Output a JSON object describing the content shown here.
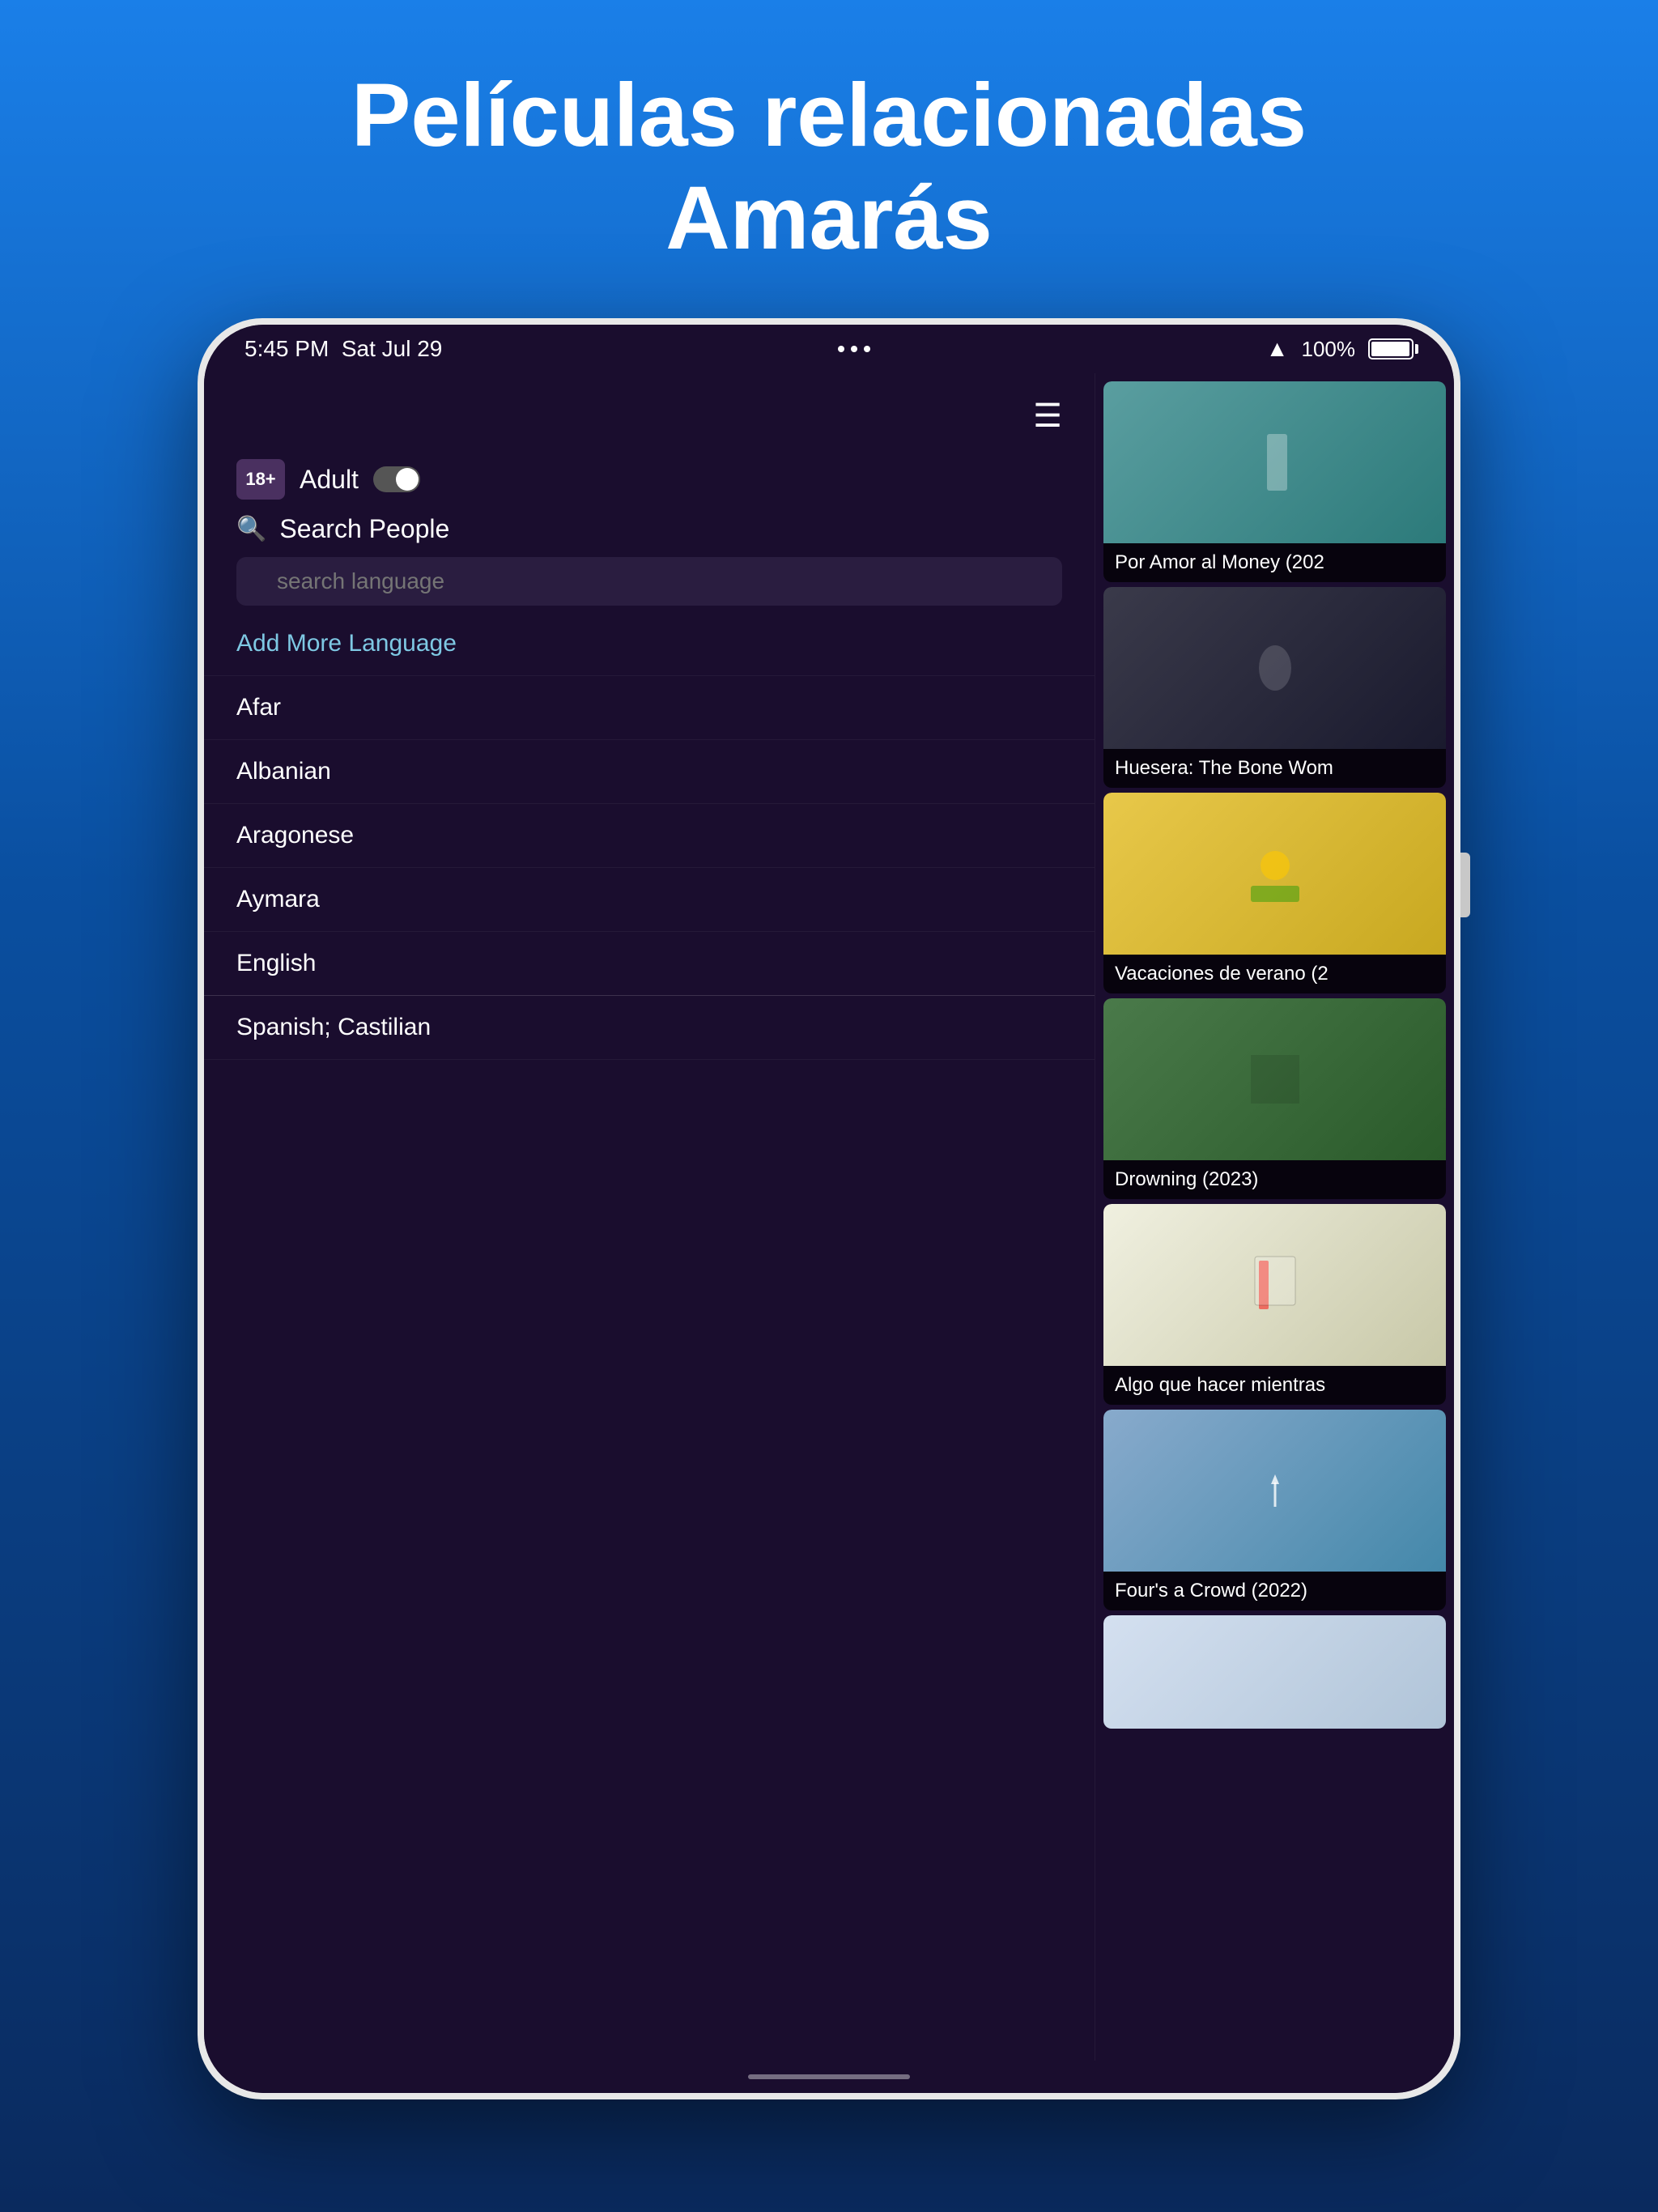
{
  "hero": {
    "title_line1": "Películas relacionadas",
    "title_line2": "Amarás"
  },
  "status_bar": {
    "time": "5:45 PM",
    "date": "Sat Jul 29",
    "wifi": "WiFi",
    "battery_percent": "100%"
  },
  "menu_icon": "☰",
  "adult_section": {
    "icon_label": "18+",
    "label": "Adult",
    "toggle_on": false
  },
  "search_people": {
    "label": "Search People"
  },
  "search_language": {
    "placeholder": "search language"
  },
  "language_list": [
    {
      "id": "add-more",
      "label": "Add More Language",
      "type": "add"
    },
    {
      "id": "afar",
      "label": "Afar",
      "type": "lang"
    },
    {
      "id": "albanian",
      "label": "Albanian",
      "type": "lang"
    },
    {
      "id": "aragonese",
      "label": "Aragonese",
      "type": "lang"
    },
    {
      "id": "aymara",
      "label": "Aymara",
      "type": "lang"
    },
    {
      "id": "english",
      "label": "English",
      "type": "lang"
    },
    {
      "id": "spanish",
      "label": "Spanish; Castilian",
      "type": "lang"
    }
  ],
  "movies": [
    {
      "id": "1",
      "title": "Por Amor al Money (202",
      "thumb_class": "thumb-1"
    },
    {
      "id": "2",
      "title": "Huesera: The Bone Wom",
      "thumb_class": "thumb-2"
    },
    {
      "id": "3",
      "title": "Vacaciones de verano (2",
      "thumb_class": "thumb-3"
    },
    {
      "id": "4",
      "title": "Drowning (2023)",
      "thumb_class": "thumb-4"
    },
    {
      "id": "5",
      "title": "Algo que hacer mientras",
      "thumb_class": "thumb-5"
    },
    {
      "id": "6",
      "title": "Four's a Crowd (2022)",
      "thumb_class": "thumb-6"
    },
    {
      "id": "7",
      "title": "",
      "thumb_class": "thumb-7"
    }
  ]
}
